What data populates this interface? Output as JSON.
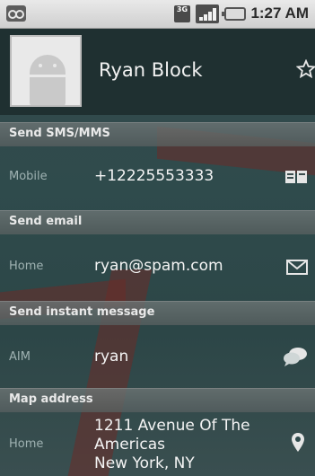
{
  "status": {
    "network_label": "3G",
    "time": "1:27 AM"
  },
  "contact": {
    "name": "Ryan Block"
  },
  "sections": {
    "sms": {
      "header": "Send SMS/MMS",
      "type": "Mobile",
      "value": "+12225553333",
      "icon": "sms-icon"
    },
    "email": {
      "header": "Send email",
      "type": "Home",
      "value": "ryan@spam.com",
      "icon": "envelope-icon"
    },
    "im": {
      "header": "Send instant message",
      "type": "AIM",
      "value": "ryan",
      "icon": "chat-bubbles-icon"
    },
    "map": {
      "header": "Map address",
      "type": "Home",
      "address_line1": "1211 Avenue Of The",
      "address_line2": "Americas",
      "address_line3": "New York, NY",
      "icon": "map-pin-icon"
    }
  },
  "colors": {
    "wallpaper": "#2f4a4c",
    "accent_stripe": "#6b2b28",
    "statusbar": "#d9d9d9"
  }
}
